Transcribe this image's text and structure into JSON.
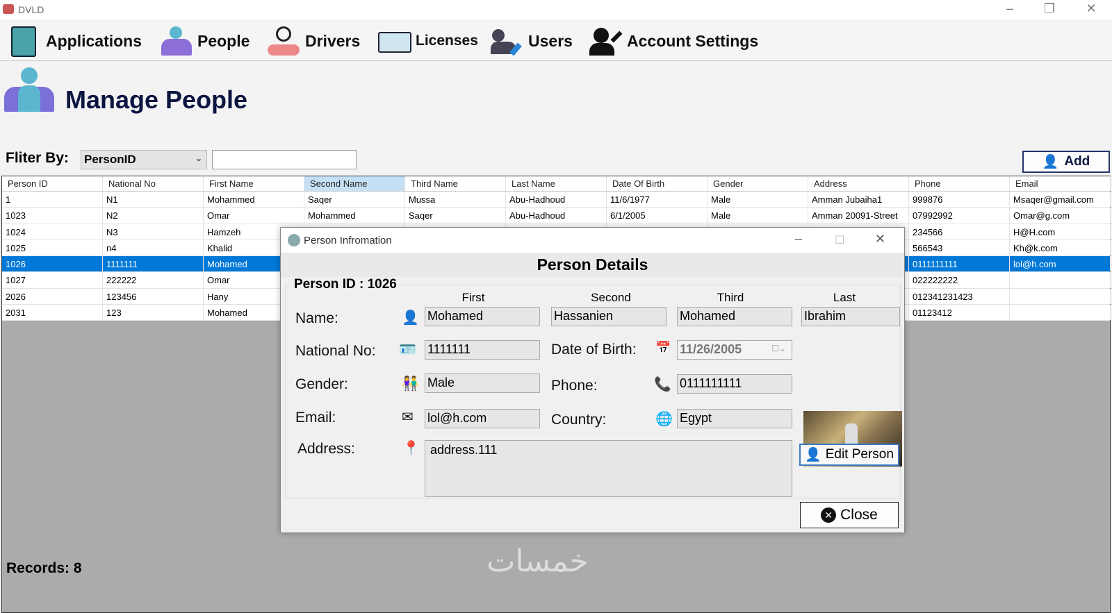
{
  "app": {
    "title": "DVLD"
  },
  "menu": [
    {
      "label": "Applications",
      "icon": "applications-icon"
    },
    {
      "label": "People",
      "icon": "people-icon"
    },
    {
      "label": "Drivers",
      "icon": "drivers-icon"
    },
    {
      "label": "Licenses",
      "icon": "license-icon"
    },
    {
      "label": "Users",
      "icon": "users-icon"
    },
    {
      "label": "Account Settings",
      "icon": "account-settings-icon"
    }
  ],
  "page": {
    "title": "Manage People",
    "filter_label": "Fliter By:",
    "filter_value": "PersonID",
    "filter_text": "",
    "add_label": "Add",
    "records": "Records: 8"
  },
  "table": {
    "columns": [
      "Person ID",
      "National No",
      "First Name",
      "Second Name",
      "Third Name",
      "Last Name",
      "Date Of Birth",
      "Gender",
      "Address",
      "Phone",
      "Email"
    ],
    "rows": [
      [
        "1",
        "N1",
        "Mohammed",
        "Saqer",
        "Mussa",
        "Abu-Hadhoud",
        "11/6/1977",
        "Male",
        "Amman Jubaiha1",
        "999876",
        "Msaqer@gmail.com"
      ],
      [
        "1023",
        "N2",
        "Omar",
        "Mohammed",
        "Saqer",
        "Abu-Hadhoud",
        "6/1/2005",
        "Male",
        "Amman 20091-Street",
        "07992992",
        "Omar@g.com"
      ],
      [
        "1024",
        "N3",
        "Hamzeh",
        "",
        "",
        "",
        "",
        "",
        "",
        "234566",
        "H@H.com"
      ],
      [
        "1025",
        "n4",
        "Khalid",
        "",
        "",
        "",
        "",
        "",
        "",
        "566543",
        "Kh@k.com"
      ],
      [
        "1026",
        "1111111",
        "Mohamed",
        "",
        "",
        "",
        "",
        "",
        "",
        "0111111111",
        "lol@h.com"
      ],
      [
        "1027",
        "222222",
        "Omar",
        "",
        "",
        "",
        "",
        "",
        "",
        "022222222",
        ""
      ],
      [
        "2026",
        "123456",
        "Hany",
        "",
        "",
        "",
        "",
        "",
        "",
        "012341231423",
        ""
      ],
      [
        "2031",
        "123",
        "Mohamed",
        "",
        "",
        "",
        "",
        "",
        "",
        "01123412",
        ""
      ]
    ],
    "selected_row": 4
  },
  "dialog": {
    "title": "Person Infromation",
    "header": "Person Details",
    "group": "Person ID : 1026",
    "col_first": "First",
    "col_second": "Second",
    "col_third": "Third",
    "col_last": "Last",
    "name_label": "Name:",
    "first": "Mohamed",
    "second": "Hassanien",
    "third": "Mohamed",
    "last": "Ibrahim",
    "national_label": "National No:",
    "national": "1111111",
    "dob_label": "Date of Birth:",
    "dob": "11/26/2005",
    "gender_label": "Gender:",
    "gender": "Male",
    "phone_label": "Phone:",
    "phone": "0111111111",
    "email_label": "Email:",
    "email": "lol@h.com",
    "country_label": "Country:",
    "country": "Egypt",
    "address_label": "Address:",
    "address": "address.111",
    "edit_label": "Edit Person",
    "close_label": "Close"
  }
}
